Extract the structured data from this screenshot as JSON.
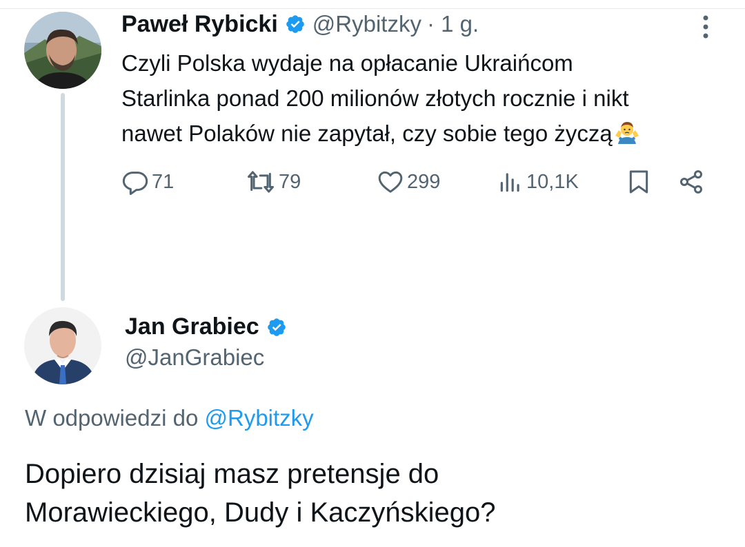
{
  "original_tweet": {
    "author_name": "Paweł Rybicki",
    "author_handle": "@Rybitzky",
    "time": "· 1 g.",
    "text_lines": [
      "Czyli Polska wydaje na opłacanie Ukraińcom",
      "Starlinka ponad 200 milionów złotych rocznie i nikt",
      "nawet Polaków nie zapytał, czy sobie tego życzą"
    ],
    "trailing_emoji": "shrug-emoji",
    "stats": {
      "replies": "71",
      "reposts": "79",
      "likes": "299",
      "views": "10,1K"
    }
  },
  "reply_tweet": {
    "author_name": "Jan Grabiec",
    "author_handle": "@JanGrabiec",
    "reply_to_prefix": "W odpowiedzi do ",
    "reply_to_handle": "@Rybitzky",
    "text_lines": [
      "Dopiero dzisiaj masz pretensje do",
      "Morawieckiego, Dudy i Kaczyńskiego?"
    ]
  },
  "icons": {
    "verified": "verified-badge-icon",
    "more": "more-vertical-icon",
    "reply": "reply-bubble-icon",
    "repost": "repost-icon",
    "like": "heart-icon",
    "views": "views-bar-chart-icon",
    "bookmark": "bookmark-icon",
    "share": "share-icon"
  },
  "colors": {
    "text_primary": "#0f1419",
    "text_secondary": "#536471",
    "accent_blue": "#1d9bf0",
    "thread_line": "#cfd9de"
  }
}
